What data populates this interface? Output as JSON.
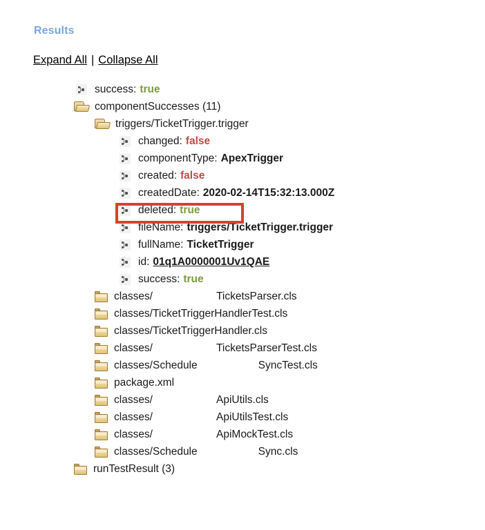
{
  "header": {
    "title": "Results",
    "expand_all": "Expand All",
    "separator": "|",
    "collapse_all": "Collapse All"
  },
  "colors": {
    "heading": "#7ba7da",
    "true": "#7d9b3f",
    "false": "#bf4b48",
    "highlight": "#d8412a"
  },
  "tree": {
    "root": {
      "key": "success:",
      "value": "true",
      "icon": "leaf-icon"
    },
    "component_successes": {
      "label": "componentSuccesses (11)",
      "icon": "folder-open-icon"
    },
    "trigger_node": {
      "label": "triggers/TicketTrigger.trigger",
      "icon": "folder-open-icon"
    },
    "trigger_fields": [
      {
        "key": "changed:",
        "value": "false",
        "kind": "false",
        "icon": "leaf-icon"
      },
      {
        "key": "componentType:",
        "value": "ApexTrigger",
        "kind": "bold",
        "icon": "leaf-icon"
      },
      {
        "key": "created:",
        "value": "false",
        "kind": "false",
        "icon": "leaf-icon"
      },
      {
        "key": "createdDate:",
        "value": "2020-02-14T15:32:13.000Z",
        "kind": "bold",
        "icon": "leaf-icon"
      },
      {
        "key": "deleted:",
        "value": "true",
        "kind": "true",
        "icon": "leaf-icon"
      },
      {
        "key": "fileName:",
        "value": "triggers/TicketTrigger.trigger",
        "kind": "bold",
        "icon": "leaf-icon"
      },
      {
        "key": "fullName:",
        "value": "TicketTrigger",
        "kind": "bold",
        "icon": "leaf-icon"
      },
      {
        "key": "id:",
        "value": "01q1A0000001Uv1QAE",
        "kind": "link",
        "icon": "leaf-icon"
      },
      {
        "key": "success:",
        "value": "true",
        "kind": "true",
        "icon": "leaf-icon"
      }
    ],
    "component_files": [
      {
        "prefix": "classes/",
        "gap": 92,
        "suffix": "TicketsParser.cls",
        "icon": "folder-closed-icon"
      },
      {
        "prefix": "classes/TicketTriggerHandlerTest.cls",
        "gap": 0,
        "suffix": "",
        "icon": "folder-closed-icon"
      },
      {
        "prefix": "classes/TicketTriggerHandler.cls",
        "gap": 0,
        "suffix": "",
        "icon": "folder-closed-icon"
      },
      {
        "prefix": "classes/",
        "gap": 92,
        "suffix": "TicketsParserTest.cls",
        "icon": "folder-closed-icon"
      },
      {
        "prefix": "classes/Schedule",
        "gap": 88,
        "suffix": "SyncTest.cls",
        "icon": "folder-closed-icon"
      },
      {
        "prefix": "package.xml",
        "gap": 0,
        "suffix": "",
        "icon": "folder-closed-icon"
      },
      {
        "prefix": "classes/",
        "gap": 92,
        "suffix": "ApiUtils.cls",
        "icon": "folder-closed-icon"
      },
      {
        "prefix": "classes/",
        "gap": 92,
        "suffix": "ApiUtilsTest.cls",
        "icon": "folder-closed-icon"
      },
      {
        "prefix": "classes/",
        "gap": 92,
        "suffix": "ApiMockTest.cls",
        "icon": "folder-closed-icon"
      },
      {
        "prefix": "classes/Schedule",
        "gap": 88,
        "suffix": "Sync.cls",
        "icon": "folder-closed-icon"
      }
    ],
    "run_test_result": {
      "label": "runTestResult (3)",
      "icon": "folder-closed-icon"
    }
  }
}
